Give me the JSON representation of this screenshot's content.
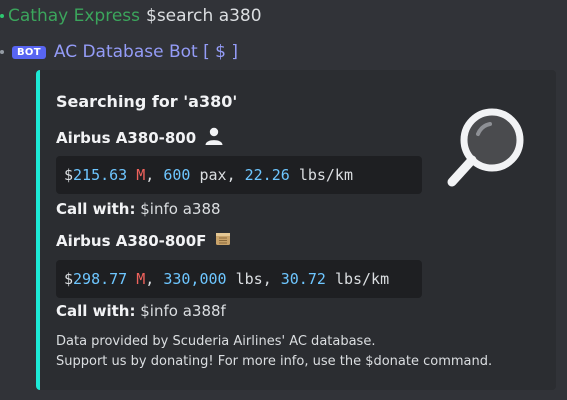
{
  "message_prev": {
    "author": "Cathay Express",
    "command": "$search a380"
  },
  "bot_message": {
    "badge": "BOT",
    "author": "AC Database Bot [ $ ]"
  },
  "embed": {
    "accent_color": "#1de9d6",
    "title": "Searching for 'a380'",
    "thumbnail_icon": "magnifying-glass-icon",
    "results": [
      {
        "name": "Airbus A380-800",
        "icon": "person-icon",
        "stats": {
          "dollar": "$",
          "price": "215.63",
          "price_unit": "M",
          "sep1": ", ",
          "capacity": "600",
          "capacity_unit": "pax",
          "sep2": ", ",
          "cost": "22.26",
          "cost_unit": "lbs/km"
        },
        "call_label": "Call with:",
        "call_cmd": "$info a388"
      },
      {
        "name": "Airbus A380-800F",
        "icon": "cargo-box-icon",
        "stats": {
          "dollar": "$",
          "price": "298.77",
          "price_unit": "M",
          "sep1": ", ",
          "capacity": "330,000",
          "capacity_unit": "lbs",
          "sep2": ", ",
          "cost": "30.72",
          "cost_unit": "lbs/km"
        },
        "call_label": "Call with:",
        "call_cmd": "$info a388f"
      }
    ],
    "footer_line1": "Data provided by Scuderia Airlines' AC database.",
    "footer_line2": "Support us by donating! For more info, use the $donate command."
  }
}
